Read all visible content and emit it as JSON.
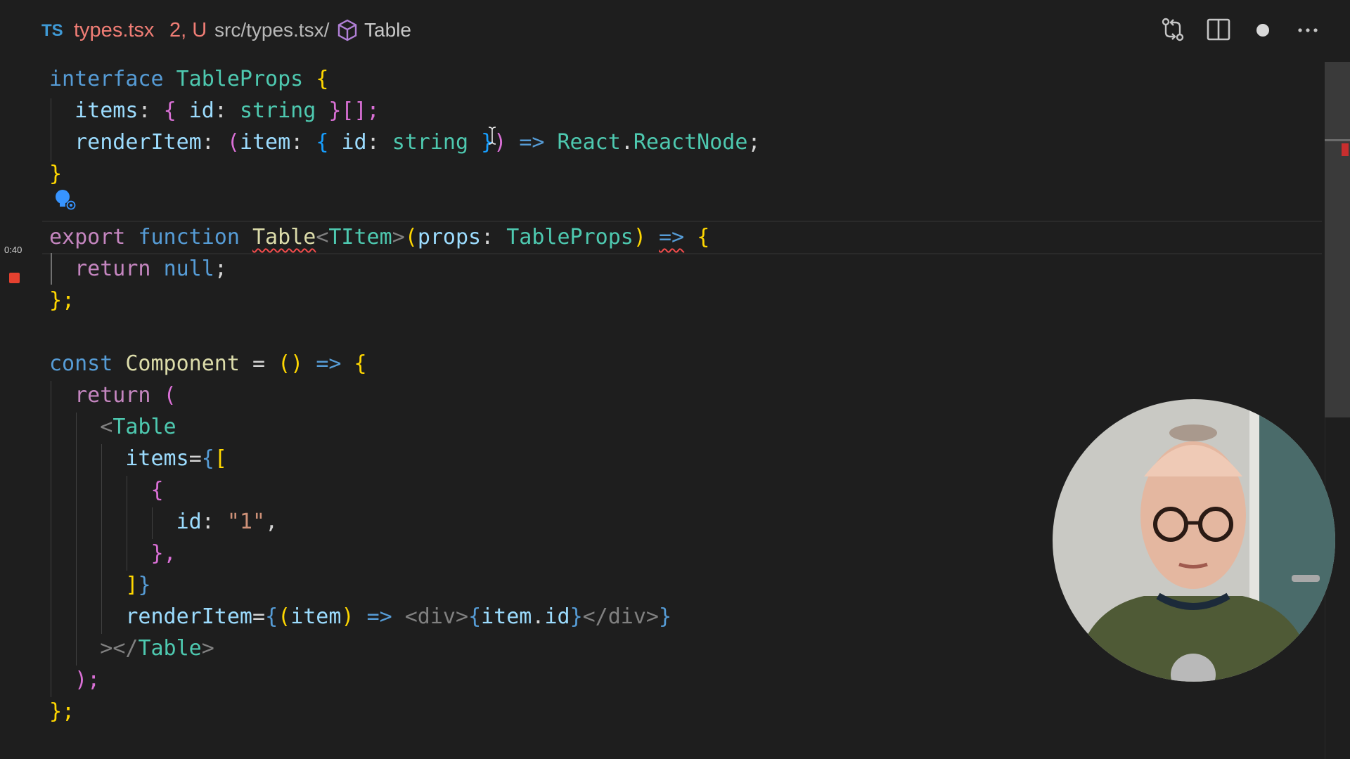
{
  "tab": {
    "lang_badge": "TS",
    "filename": "types.tsx",
    "status": "2, U"
  },
  "breadcrumb": {
    "path": "src/types.tsx/",
    "symbol": "Table"
  },
  "toolbar_icons": [
    "open-changes-icon",
    "split-editor-icon",
    "unsaved-dot-icon",
    "more-actions-icon"
  ],
  "gutter": {
    "timestamp": "0:40"
  },
  "code": {
    "l1": {
      "kw": "interface",
      "name": "TableProps",
      "brace": "{"
    },
    "l2": {
      "prop": "items",
      "colon": ":",
      "ob": "{",
      "id": "id",
      "colon2": ":",
      "type": "string",
      "rest": "}[];"
    },
    "l3": {
      "prop": "renderItem",
      "colon": ":",
      "open": "(",
      "item": "item",
      "colon2": ":",
      "ob": "{",
      "id": "id",
      "colon3": ":",
      "type": "string",
      "cb": "}",
      "close": ")",
      "arrow": "=>",
      "react": "React",
      "dot": ".",
      "node": "ReactNode",
      "semi": ";"
    },
    "l4": {
      "text": "}"
    },
    "l6": {
      "export": "export",
      "function": "function",
      "name": "Table",
      "lt": "<",
      "generic": "TItem",
      "gt": ">",
      "open": "(",
      "param": "props",
      "colon": ":",
      "type": "TableProps",
      "close": ")",
      "arrow": "=>",
      "brace": "{"
    },
    "l7": {
      "kw": "return",
      "value": "null",
      "semi": ";"
    },
    "l8": {
      "text": "};"
    },
    "l10": {
      "kw": "const",
      "name": "Component",
      "eq": "=",
      "parens": "()",
      "arrow": "=>",
      "brace": "{"
    },
    "l11": {
      "kw": "return",
      "paren": "("
    },
    "l12": {
      "lt": "<",
      "tag": "Table"
    },
    "l13": {
      "attr": "items",
      "eq": "=",
      "ob": "{",
      "bracket": "["
    },
    "l14": {
      "text": "{"
    },
    "l15": {
      "key": "id",
      "colon": ":",
      "value": "\"1\"",
      "comma": ","
    },
    "l16": {
      "text": "},"
    },
    "l17": {
      "bracket": "]",
      "cb": "}"
    },
    "l18": {
      "attr": "renderItem",
      "eq": "=",
      "ob": "{",
      "open": "(",
      "param": "item",
      "close": ")",
      "arrow": "=>",
      "divopen": "<div>",
      "eob": "{",
      "expr": "item",
      "dot": ".",
      "prop": "id",
      "ecb": "}",
      "divclose": "</div>",
      "cb": "}"
    },
    "l19": {
      "gt": ">",
      "close": "</Table>",
      "lt": "</",
      "tag": "Table",
      "end": ">"
    },
    "l20": {
      "text": ");"
    },
    "l21": {
      "text": "};"
    }
  }
}
